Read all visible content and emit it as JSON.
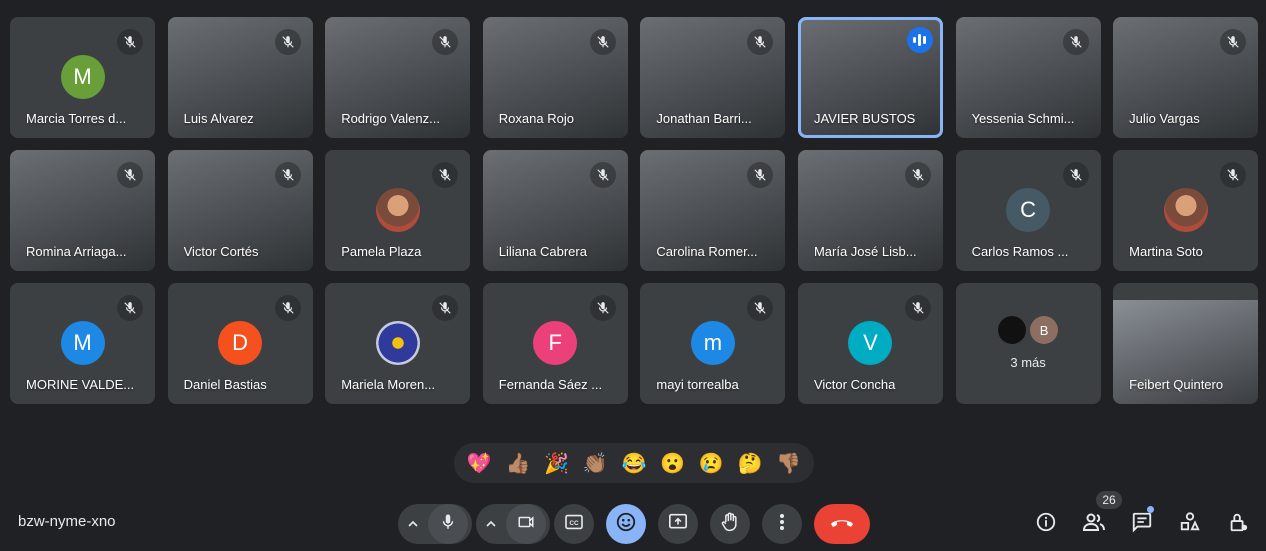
{
  "participants": [
    {
      "name": "Marcia Torres d...",
      "kind": "initial",
      "initial": "M",
      "color": "#689f38",
      "muted": true
    },
    {
      "name": "Luis Alvarez",
      "kind": "video",
      "muted": true
    },
    {
      "name": "Rodrigo Valenz...",
      "kind": "video",
      "muted": true
    },
    {
      "name": "Roxana Rojo",
      "kind": "video",
      "muted": true
    },
    {
      "name": "Jonathan Barri...",
      "kind": "video",
      "muted": true
    },
    {
      "name": "JAVIER BUSTOS",
      "kind": "video",
      "muted": false,
      "speaking": true
    },
    {
      "name": "Yessenia Schmi...",
      "kind": "video",
      "muted": true
    },
    {
      "name": "Julio Vargas",
      "kind": "video",
      "muted": true
    },
    {
      "name": "Romina Arriaga...",
      "kind": "video",
      "muted": true
    },
    {
      "name": "Victor Cortés",
      "kind": "video",
      "muted": true
    },
    {
      "name": "Pamela Plaza",
      "kind": "photo",
      "muted": true
    },
    {
      "name": "Liliana Cabrera",
      "kind": "video",
      "muted": true
    },
    {
      "name": "Carolina Romer...",
      "kind": "video",
      "muted": true
    },
    {
      "name": "María José Lisb...",
      "kind": "video",
      "muted": true
    },
    {
      "name": "Carlos Ramos ...",
      "kind": "initial",
      "initial": "C",
      "color": "#455a64",
      "muted": true
    },
    {
      "name": "Martina Soto",
      "kind": "photo",
      "muted": true
    },
    {
      "name": "MORINE VALDE...",
      "kind": "initial",
      "initial": "M",
      "color": "#1e88e5",
      "muted": true
    },
    {
      "name": "Daniel Bastias",
      "kind": "initial",
      "initial": "D",
      "color": "#f4511e",
      "muted": true
    },
    {
      "name": "Mariela Moren...",
      "kind": "emblem",
      "muted": true
    },
    {
      "name": "Fernanda Sáez ...",
      "kind": "initial",
      "initial": "F",
      "color": "#ec407a",
      "muted": true
    },
    {
      "name": "mayi torrealba",
      "kind": "initial",
      "initial": "m",
      "color": "#1e88e5",
      "muted": true
    },
    {
      "name": "Victor Concha",
      "kind": "initial",
      "initial": "V",
      "color": "#00acc1",
      "muted": true
    },
    {
      "name": "",
      "kind": "more",
      "label": "3 más",
      "avatars": [
        {
          "initial": "",
          "color": "#111111"
        },
        {
          "initial": "B",
          "color": "#8d6e63"
        }
      ],
      "muted": false
    },
    {
      "name": "Feibert Quintero",
      "kind": "feibert",
      "muted": false
    }
  ],
  "reactions": [
    "💖",
    "👍🏽",
    "🎉",
    "👏🏽",
    "😂",
    "😮",
    "😢",
    "🤔",
    "👎🏽"
  ],
  "meeting_code": "bzw-nyme-xno",
  "participant_count": "26",
  "icons": {
    "mic": "mic-icon",
    "camera": "camera-icon",
    "captions": "captions-icon",
    "emoji": "emoji-icon",
    "present": "present-icon",
    "hand": "raise-hand-icon",
    "more": "more-vert-icon",
    "end": "end-call-icon",
    "info": "info-icon",
    "people": "people-icon",
    "chat": "chat-icon",
    "activities": "activities-icon",
    "host": "host-controls-icon"
  },
  "colors": {
    "background": "#202124",
    "tile": "#3c4043",
    "accent": "#8ab4f8",
    "end_call": "#ea4335"
  }
}
